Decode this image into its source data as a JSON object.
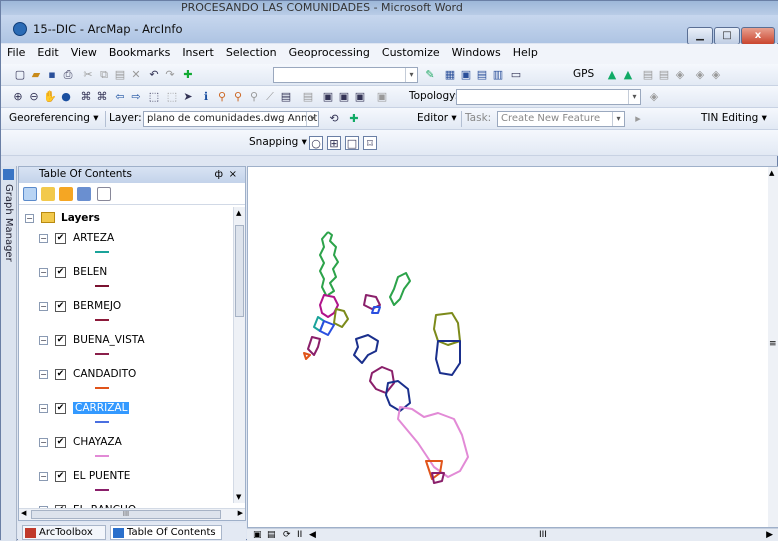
{
  "word_window": {
    "title": "PROCESANDO LAS COMUNIDADES - Microsoft Word"
  },
  "window": {
    "title": "15--DIC - ArcMap - ArcInfo",
    "minimize_icon": "minimize-icon",
    "maximize_icon": "maximize-icon",
    "close_label": "x"
  },
  "menu": [
    "File",
    "Edit",
    "View",
    "Bookmarks",
    "Insert",
    "Selection",
    "Geoprocessing",
    "Customize",
    "Windows",
    "Help"
  ],
  "toolbar": {
    "gps_label": "GPS",
    "topology_label": "Topology:",
    "georef_label": "Georeferencing",
    "layer_label": "Layer:",
    "layer_value": "plano de comunidades.dwg Annotati",
    "editor_label": "Editor",
    "task_label": "Task:",
    "task_value": "Create New Feature",
    "tin_label": "TIN Editing",
    "snapping_label": "Snapping"
  },
  "side_tab": {
    "label": "Graph Manager"
  },
  "toc": {
    "title": "Table Of Contents",
    "pin": "ф",
    "close": "×",
    "root_label": "Layers",
    "layers": [
      {
        "name": "ARTEZA",
        "color": "#1aa39a",
        "selected": false
      },
      {
        "name": "BELEN",
        "color": "#7a1230",
        "selected": false
      },
      {
        "name": "BERMEJO",
        "color": "#8c1a3a",
        "selected": false
      },
      {
        "name": "BUENA_VISTA",
        "color": "#8a1f4a",
        "selected": false
      },
      {
        "name": "CANDADITO",
        "color": "#e0541a",
        "selected": false
      },
      {
        "name": "CARRIZAL",
        "color": "#4a6fe0",
        "selected": true
      },
      {
        "name": "CHAYAZA",
        "color": "#e28ad6",
        "selected": false
      },
      {
        "name": "EL PUENTE",
        "color": "#8a1f6a",
        "selected": false
      },
      {
        "name": "EL_RANCHO",
        "color": "#7a1fa0",
        "selected": false
      }
    ],
    "hscroll_text": "III"
  },
  "bottom_tabs": {
    "arctoolbox": "ArcToolbox",
    "toc": "Table Of Contents"
  },
  "map_status": {
    "pause": "II",
    "scroll_text": "III"
  }
}
